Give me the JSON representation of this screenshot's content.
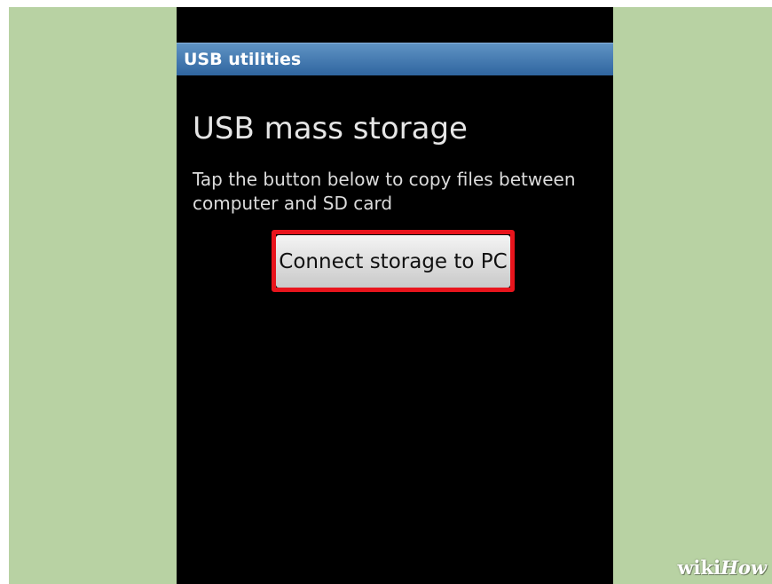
{
  "window": {
    "title": "USB utilities"
  },
  "main": {
    "heading": "USB mass storage",
    "description": "Tap the button below to copy files between computer and SD card",
    "connect_button_label": "Connect storage to PC"
  },
  "watermark": {
    "brand_wiki": "wiki",
    "brand_how": "How"
  },
  "colors": {
    "background": "#b8d2a3",
    "titlebar": "#3f74ad",
    "highlight": "#e8141c"
  }
}
